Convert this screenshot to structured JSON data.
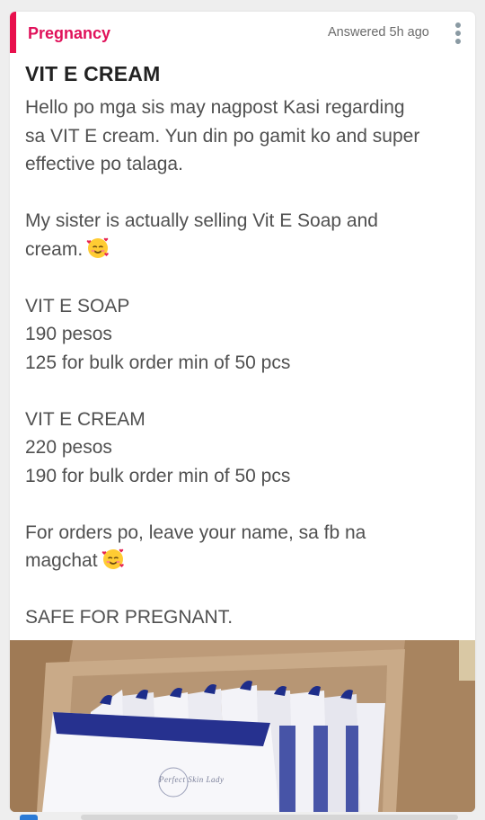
{
  "post": {
    "category": "Pregnancy",
    "answered": "Answered 5h ago",
    "title": "VIT E CREAM",
    "paragraphs": [
      [
        "Hello po mga sis may nagpost Kasi regarding",
        "sa VIT E cream. Yun din po gamit ko and super",
        "effective po talaga."
      ],
      [
        "My sister is actually selling Vit E Soap and",
        "cream."
      ],
      [
        "VIT E SOAP",
        "190 pesos",
        "125 for bulk order min of 50 pcs"
      ],
      [
        "VIT E CREAM",
        "220 pesos",
        "190 for bulk order min of 50 pcs"
      ],
      [
        "For orders po, leave your name, sa fb na",
        "magchat"
      ],
      [
        "SAFE FOR PREGNANT."
      ]
    ],
    "photo_brand_text": "Perfect Skin Lady"
  },
  "icons": {
    "menu": "kebab-menu-icon",
    "emoji": "smiling-face-with-hearts-icon"
  },
  "colors": {
    "accent": "#e8104d",
    "category": "#e0115a",
    "text": "#505050",
    "title": "#222222"
  }
}
